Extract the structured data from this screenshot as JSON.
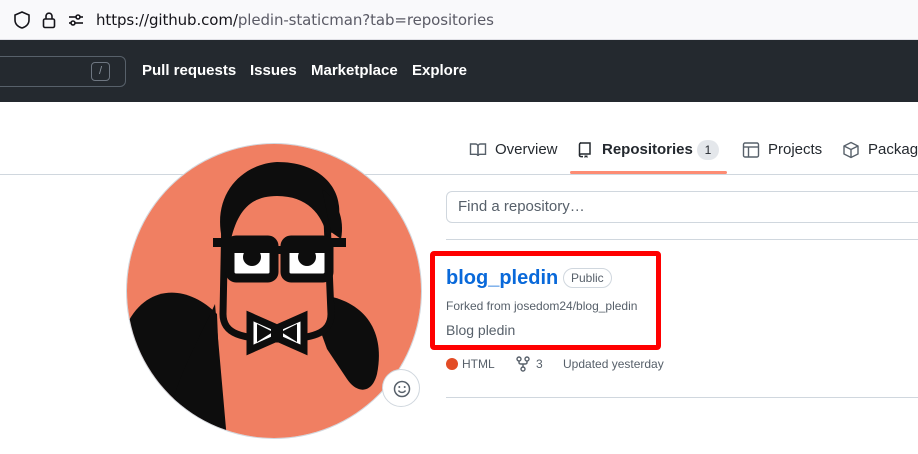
{
  "browser": {
    "url_host": "https://github.com/",
    "url_path": "pledin-staticman?tab=repositories"
  },
  "header": {
    "search_shortcut": "/",
    "nav": [
      "Pull requests",
      "Issues",
      "Marketplace",
      "Explore"
    ]
  },
  "tabs": {
    "overview": "Overview",
    "repositories": "Repositories",
    "repositories_count": "1",
    "projects": "Projects",
    "packages": "Packages"
  },
  "repos": {
    "search_placeholder": "Find a repository…",
    "items": [
      {
        "name": "blog_pledin",
        "visibility": "Public",
        "forked_from": "Forked from josedom24/blog_pledin",
        "description": "Blog pledin",
        "language": "HTML",
        "language_color": "#e34c26",
        "forks": "3",
        "updated": "Updated yesterday"
      }
    ]
  },
  "colors": {
    "header_bg": "#24292f",
    "link": "#0969da",
    "active_tab_underline": "#fd8c73",
    "highlight": "#ff0000",
    "avatar_bg": "#f07f62"
  }
}
